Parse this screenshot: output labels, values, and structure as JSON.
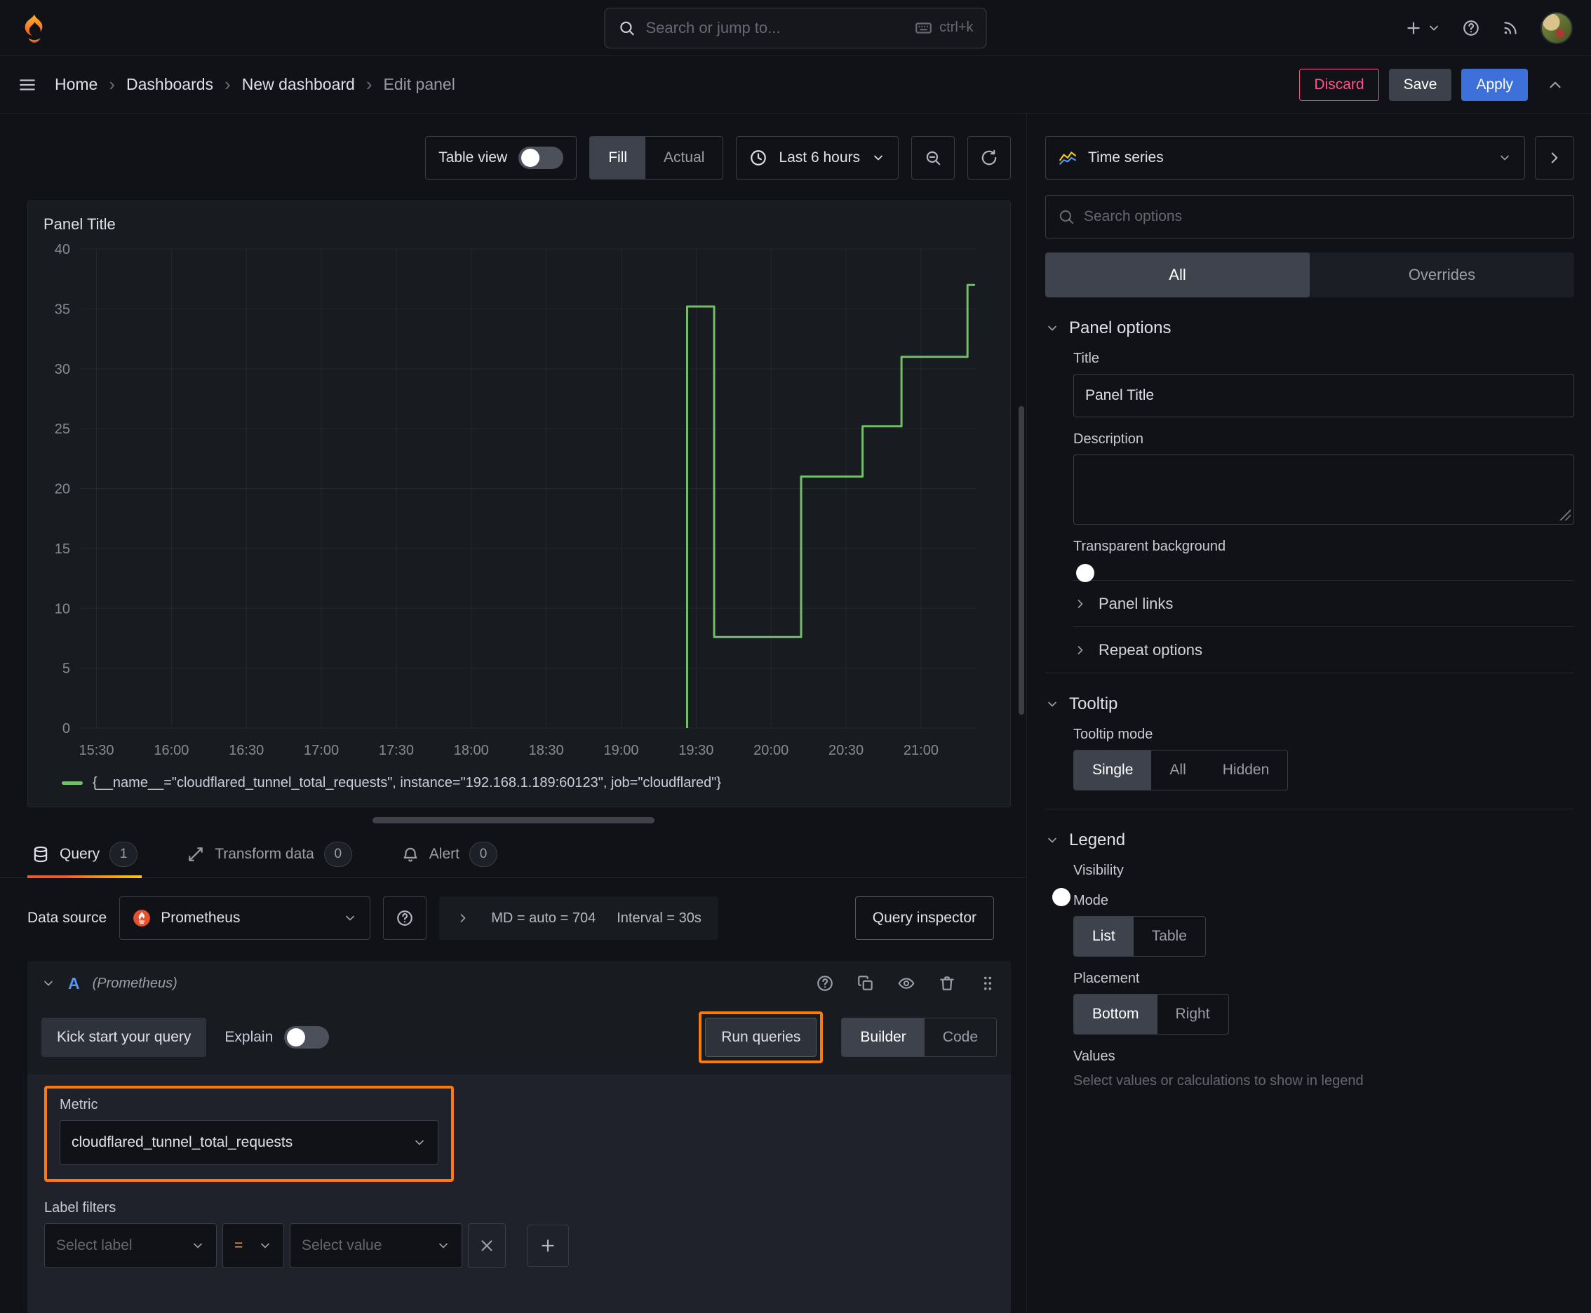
{
  "colors": {
    "accent_orange": "#ff780a",
    "apply_blue": "#3d71d9",
    "discard_red": "#ff5286",
    "series_green": "#73bf69"
  },
  "topnav": {
    "search_placeholder": "Search or jump to...",
    "search_shortcut": "ctrl+k"
  },
  "breadcrumb": {
    "items": [
      "Home",
      "Dashboards",
      "New dashboard",
      "Edit panel"
    ],
    "discard": "Discard",
    "save": "Save",
    "apply": "Apply"
  },
  "toolbar": {
    "table_view": "Table view",
    "fill": "Fill",
    "actual": "Actual",
    "time_range": "Last 6 hours"
  },
  "panel": {
    "title": "Panel Title"
  },
  "chart_data": {
    "type": "line",
    "line_style": "step",
    "color": "#73bf69",
    "title": "Panel Title",
    "grid": true,
    "legend_position": "bottom",
    "xlim": [
      15.39,
      21.37
    ],
    "ylim": [
      0,
      40
    ],
    "y_ticks": [
      0,
      5,
      10,
      15,
      20,
      25,
      30,
      35,
      40
    ],
    "x_ticks": [
      {
        "v": 15.5,
        "label": "15:30"
      },
      {
        "v": 16.0,
        "label": "16:00"
      },
      {
        "v": 16.5,
        "label": "16:30"
      },
      {
        "v": 17.0,
        "label": "17:00"
      },
      {
        "v": 17.5,
        "label": "17:30"
      },
      {
        "v": 18.0,
        "label": "18:00"
      },
      {
        "v": 18.5,
        "label": "18:30"
      },
      {
        "v": 19.0,
        "label": "19:00"
      },
      {
        "v": 19.5,
        "label": "19:30"
      },
      {
        "v": 20.0,
        "label": "20:00"
      },
      {
        "v": 20.5,
        "label": "20:30"
      },
      {
        "v": 21.0,
        "label": "21:00"
      }
    ],
    "series": [
      {
        "name": "{__name__=\"cloudflared_tunnel_total_requests\", instance=\"192.168.1.189:60123\", job=\"cloudflared\"}",
        "points": [
          [
            19.44,
            0
          ],
          [
            19.44,
            35.2
          ],
          [
            19.62,
            35.2
          ],
          [
            19.62,
            7.6
          ],
          [
            20.2,
            7.6
          ],
          [
            20.2,
            21
          ],
          [
            20.61,
            21
          ],
          [
            20.61,
            25.2
          ],
          [
            20.87,
            25.2
          ],
          [
            20.87,
            31
          ],
          [
            21.31,
            31
          ],
          [
            21.31,
            37
          ],
          [
            21.36,
            37
          ]
        ]
      }
    ]
  },
  "tabs": {
    "query": {
      "label": "Query",
      "count": "1"
    },
    "transform": {
      "label": "Transform data",
      "count": "0"
    },
    "alert": {
      "label": "Alert",
      "count": "0"
    }
  },
  "query": {
    "datasource_label": "Data source",
    "datasource": "Prometheus",
    "stat_md": "MD = auto = 704",
    "stat_interval": "Interval = 30s",
    "inspector": "Query inspector",
    "ref_id": "A",
    "ref_note": "(Prometheus)",
    "kickstart": "Kick start your query",
    "explain": "Explain",
    "run_queries": "Run queries",
    "builder": "Builder",
    "code": "Code",
    "metric_label": "Metric",
    "metric_value": "cloudflared_tunnel_total_requests",
    "label_filters": "Label filters",
    "select_label": "Select label",
    "operator": "=",
    "select_value": "Select value"
  },
  "sidebar": {
    "visualization": "Time series",
    "search_placeholder": "Search options",
    "tab_all": "All",
    "tab_overrides": "Overrides",
    "panel_options": {
      "header": "Panel options",
      "title_label": "Title",
      "title_value": "Panel Title",
      "description_label": "Description",
      "transparent_label": "Transparent background"
    },
    "panel_links": "Panel links",
    "repeat_options": "Repeat options",
    "tooltip": {
      "header": "Tooltip",
      "mode_label": "Tooltip mode",
      "options": [
        "Single",
        "All",
        "Hidden"
      ]
    },
    "legend": {
      "header": "Legend",
      "visibility_label": "Visibility",
      "mode_label": "Mode",
      "mode_options": [
        "List",
        "Table"
      ],
      "placement_label": "Placement",
      "placement_options": [
        "Bottom",
        "Right"
      ],
      "values_label": "Values",
      "values_help": "Select values or calculations to show in legend"
    }
  },
  "icons": {
    "grafana-logo": "orange-flame",
    "search-icon": "magnifier",
    "keyboard-icon": "keyboard-outline",
    "add-icon": "+",
    "chevron-down-icon": "v-chevron",
    "chevron-right-icon": "right-chevron",
    "chevron-up-icon": "up-chevron",
    "help-icon": "question-circle",
    "news-icon": "rss-arcs",
    "menu-icon": "three-lines",
    "clock-icon": "clock-face",
    "zoom-out-icon": "magnifier-minus",
    "refresh-icon": "circular-arrow",
    "timeseries-icon": "mini-line-chart",
    "database-icon": "stacked-cylinder",
    "transform-icon": "diagonal-arrows",
    "bell-icon": "bell",
    "prometheus-icon": "torch-flame-circle",
    "copy-icon": "two-rects",
    "eye-icon": "eye",
    "trash-icon": "trash-can",
    "grip-icon": "six-dots",
    "close-icon": "x-cross"
  }
}
